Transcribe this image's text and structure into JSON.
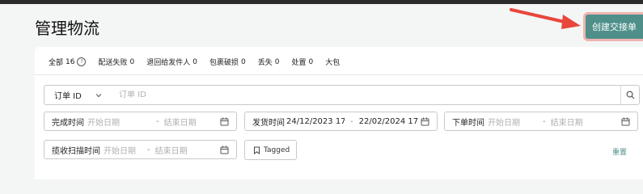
{
  "page": {
    "title": "管理物流"
  },
  "header": {
    "create_button": "创建交接单"
  },
  "tabs": [
    {
      "label": "全部",
      "count": "16",
      "active": true,
      "help": "?"
    },
    {
      "label": "配送失败",
      "count": "0"
    },
    {
      "label": "退回给发件人",
      "count": "0"
    },
    {
      "label": "包裹破损",
      "count": "0"
    },
    {
      "label": "丢失",
      "count": "0"
    },
    {
      "label": "处置",
      "count": "0"
    },
    {
      "label": "大包",
      "count": ""
    }
  ],
  "search": {
    "type_label": "订单 ID",
    "placeholder": "订单 ID"
  },
  "filters": {
    "complete_time": {
      "label": "完成时间",
      "start_placeholder": "开始日期",
      "end_placeholder": "结束日期",
      "dash": "-"
    },
    "ship_time": {
      "label": "发货时间",
      "start_value": "24/12/2023 17:(",
      "end_value": "22/02/2024 17:",
      "dash": "-"
    },
    "order_time": {
      "label": "下单时间",
      "start_placeholder": "开始日期",
      "end_placeholder": "结束日期",
      "dash": "-"
    },
    "scan_time": {
      "label": "揽收扫描时间",
      "start_placeholder": "开始日期",
      "end_placeholder": "结束日期",
      "dash": "-"
    }
  },
  "tagged": {
    "label": "Tagged"
  },
  "reset": {
    "label": "重置"
  },
  "colors": {
    "accent": "#4e8f8a",
    "annotation": "#e8473b"
  }
}
